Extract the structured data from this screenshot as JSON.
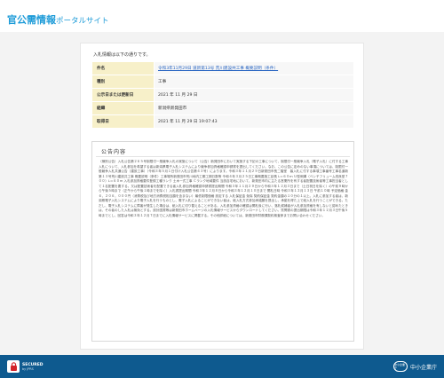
{
  "header": {
    "logo_strong": "官公需情報",
    "logo_light": "ポータルサイト"
  },
  "intro": "入札情報は以下の通りです。",
  "info_rows": [
    {
      "label": "件名",
      "value": "令和3年11月29日 道新第13号 荒川建設共工事 概要説明（条件）"
    },
    {
      "label": "種別",
      "value": "工事"
    },
    {
      "label": "公示日または更新日",
      "value": "2021 年 11 月 29 日"
    },
    {
      "label": "組織",
      "value": "新潟県新発田市"
    },
    {
      "label": "取得日",
      "value": "2021 年 11 月 29 日 19:07:43"
    }
  ],
  "notice": {
    "title": "公告内容",
    "body": "（様別公告）入札公告第２６５号制限付一般競争入札の実施について（公告）新発田市において実施する下記の工事について、制限付一般競争入札（電子入札）に付する工事入札について、入札参加を希望する者は新潟県電子入札システムにより競争参加資格確認申請書を提出してください。なお、この公告に定めのない事項については、制限付一般競争入札共通公告（建設工事）（令和３年５月１日付け入札公告第４３号）によります。令和３年１１月２９日新発田市長二階堂　馨入札に付する事項工事番号工事名道新第１３号荒川建設共工事 概要説明（条件）工事場所新発田市荒川地内工期工期日数等 令和４年３月２５日工事概要施工延長 L＝６０ｍ Ｕ型側溝（ベンチフリューム改良型７００）L＝６０ｍ 入札参加資格要件登録工種ランク 土木一式工事 Ｃランク地域要件 当該自宅地において、新発田市内に主たる営業所を有する者配置技術者等工事担当者として１名配置を要する。又は配置技術者を配置できる者入札参加資格確認申請書提出期間 令和３年１１月２９日から令和３年１２月３日まで（土日祝日を除く）の午前９時から午後５時まで（正午から午後１時までを除く）入札書提出期間 令和３年１２月８日から令和３年１２月１０日まで 開札日時 令和３年１２月１３日 午前１０時 予定価格 金６，２０６，０００円（消費税及び地方消費税相当額を含まない）最低制限価格 設定する 入札保証金 免除 契約保証金 契約金額の１０分の１以上。入札に参加する者は、新潟県電子入札システムにより電子入札を行うものとし、電子入札によることができない者は、紙入札方式参加承諾願を提出し、承諾を得た上で紙入札を行うことができる。ただし、電子入札システムに障害が発生した場合は、紙入札に切り替えることがある。入札参加資格の確認は開札後に行い、落札候補者が入札参加資格を有しないと認めたときは、その者のした入札は無効とする。設計図書等は新発田市ホームページの入札情報サービスからダウンロードしてください。質問書の提出期限は令和３年１２月３日午後５時までとし、回答は令和３年１２月７日までに入札情報サービスに掲載する。その他詳細については、新発田市財務課契約検査係までお問い合わせください。"
  },
  "footer": {
    "secured_main": "SECURED",
    "secured_sub": "by JPRS",
    "sme_badge": "中小企業庁",
    "sme_text": "中小企業庁"
  }
}
